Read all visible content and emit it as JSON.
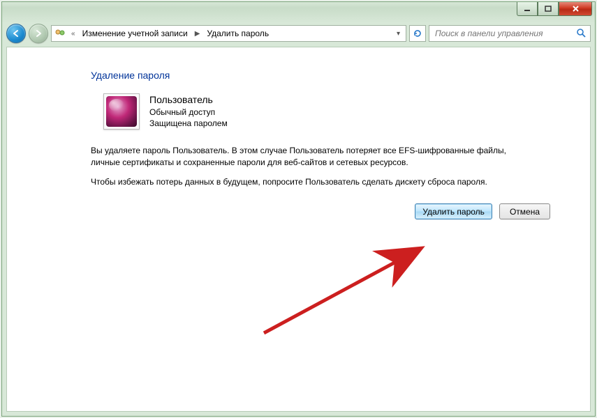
{
  "breadcrumb": {
    "prefix_glyph": "«",
    "item1": "Изменение учетной записи",
    "item2": "Удалить пароль"
  },
  "search": {
    "placeholder": "Поиск в панели управления"
  },
  "page": {
    "title": "Удаление пароля"
  },
  "user": {
    "name": "Пользователь",
    "role": "Обычный доступ",
    "protection": "Защищена паролем"
  },
  "body": {
    "p1": "Вы удаляете пароль Пользователь. В этом случае Пользователь потеряет все EFS-шифрованные файлы, личные сертификаты и сохраненные пароли для веб-сайтов и сетевых ресурсов.",
    "p2": "Чтобы избежать потерь данных в будущем, попросите Пользователь сделать дискету сброса пароля."
  },
  "buttons": {
    "delete": "Удалить пароль",
    "cancel": "Отмена"
  }
}
